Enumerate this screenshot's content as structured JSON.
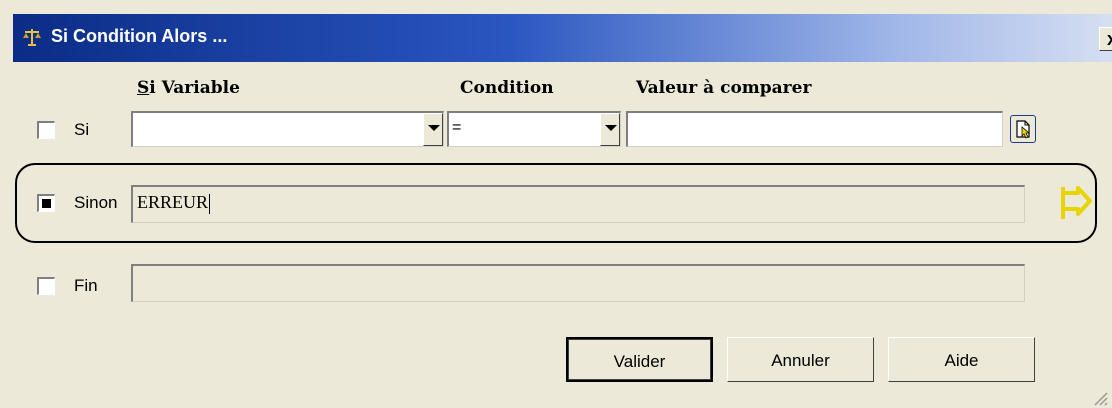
{
  "window": {
    "title": "Si Condition Alors ...",
    "close_label": "x"
  },
  "headers": {
    "variable_prefix": "S",
    "variable_rest": "i Variable",
    "condition": "Condition",
    "valeur": "Valeur à comparer"
  },
  "rows": {
    "si": {
      "label": "Si",
      "checked": false,
      "variable": "",
      "condition": "=",
      "valeur": ""
    },
    "sinon": {
      "label": "Sinon",
      "checked": true,
      "value": "ERREUR"
    },
    "fin": {
      "label": "Fin",
      "checked": false,
      "value": ""
    }
  },
  "buttons": {
    "valider": "Valider",
    "annuler": "Annuler",
    "aide": "Aide"
  },
  "icons": {
    "title": "scales-icon",
    "pick": "pick-document-icon",
    "flag": "flag-arrow-icon",
    "accent": "#f0e000"
  }
}
